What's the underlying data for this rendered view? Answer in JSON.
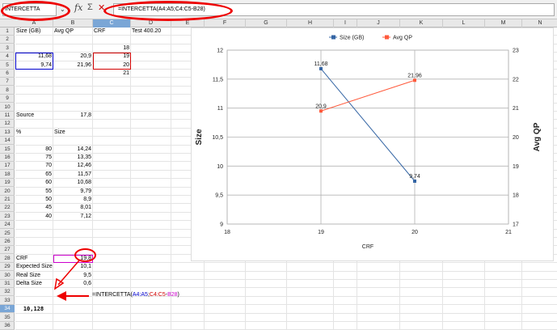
{
  "formula_bar": {
    "name_box": "INTERCETTA",
    "formula": "=INTERCETTA(A4:A5;C4:C5-B28)"
  },
  "icons": {
    "namebox_dropdown": "chevron-down-icon",
    "function_wizard": "fx-icon",
    "sum": "sigma-icon",
    "cancel": "close-icon"
  },
  "columns": [
    "A",
    "B",
    "C",
    "D",
    "E",
    "F",
    "G",
    "H",
    "I",
    "J",
    "K",
    "L",
    "M",
    "N"
  ],
  "rows": [
    "1",
    "2",
    "3",
    "4",
    "5",
    "6",
    "7",
    "8",
    "9",
    "10",
    "11",
    "12",
    "13",
    "14",
    "15",
    "16",
    "17",
    "18",
    "19",
    "20",
    "21",
    "22",
    "23",
    "24",
    "25",
    "26",
    "27",
    "28",
    "29",
    "30",
    "31",
    "32",
    "33",
    "34",
    "35",
    "36"
  ],
  "cells": {
    "A1": "Size (GB)",
    "B1": "Avg QP",
    "C1": "CRF",
    "D1": "Test 400.20",
    "C3": "18",
    "A4": "11,68",
    "B4": "20,9",
    "C4": "19",
    "A5": "9,74",
    "B5": "21,96",
    "C5": "20",
    "C6": "21",
    "A11": "Source",
    "B11": "17,8",
    "A13": "%",
    "B13": "Size",
    "A15": "80",
    "B15": "14,24",
    "A16": "75",
    "B16": "13,35",
    "A17": "70",
    "B17": "12,46",
    "A18": "65",
    "B18": "11,57",
    "A19": "60",
    "B19": "10,68",
    "A20": "55",
    "B20": "9,79",
    "A21": "50",
    "B21": "8,9",
    "A22": "45",
    "B22": "8,01",
    "A23": "40",
    "B23": "7,12",
    "A28": "CRF",
    "B28": "19,8",
    "A29": "Expected Size",
    "B29": "10,1",
    "A30": "Real Size",
    "B30": "9,5",
    "A31": "Delta Size",
    "B31": "0,6",
    "A34": "10,128"
  },
  "edit_cell": {
    "prefix": "=INTERCETTA(",
    "ref1": "A4:A5",
    "sep": ";",
    "ref2": "C4:C5",
    "op": "-",
    "ref3": "B28",
    "suffix": ")",
    "colors": {
      "ref1": "#0000cc",
      "ref2": "#d00000",
      "ref3": "#cc00cc"
    }
  },
  "chart_data": {
    "type": "scatter",
    "xlabel": "CRF",
    "ylabel": "Size",
    "y2label": "Avg QP",
    "xlim": [
      18,
      21
    ],
    "ylim": [
      9,
      12
    ],
    "y2lim": [
      17,
      23
    ],
    "xticks": [
      "18",
      "19",
      "20",
      "21"
    ],
    "yticks": [
      "9",
      "9,5",
      "10",
      "10,5",
      "11",
      "11,5",
      "12"
    ],
    "y2ticks": [
      "17",
      "18",
      "19",
      "20",
      "21",
      "22",
      "23"
    ],
    "legend_position": "top",
    "grid": true,
    "series": [
      {
        "name": "Size (GB)",
        "axis": "left",
        "color": "#3465a4",
        "x": [
          19,
          20
        ],
        "y": [
          11.68,
          9.74
        ],
        "labels": [
          "11,68",
          "9,74"
        ]
      },
      {
        "name": "Avg QP",
        "axis": "right",
        "color": "#ff5a3c",
        "x": [
          19,
          20
        ],
        "y": [
          20.9,
          21.96
        ],
        "labels": [
          "20,9",
          "21,96"
        ]
      }
    ]
  }
}
